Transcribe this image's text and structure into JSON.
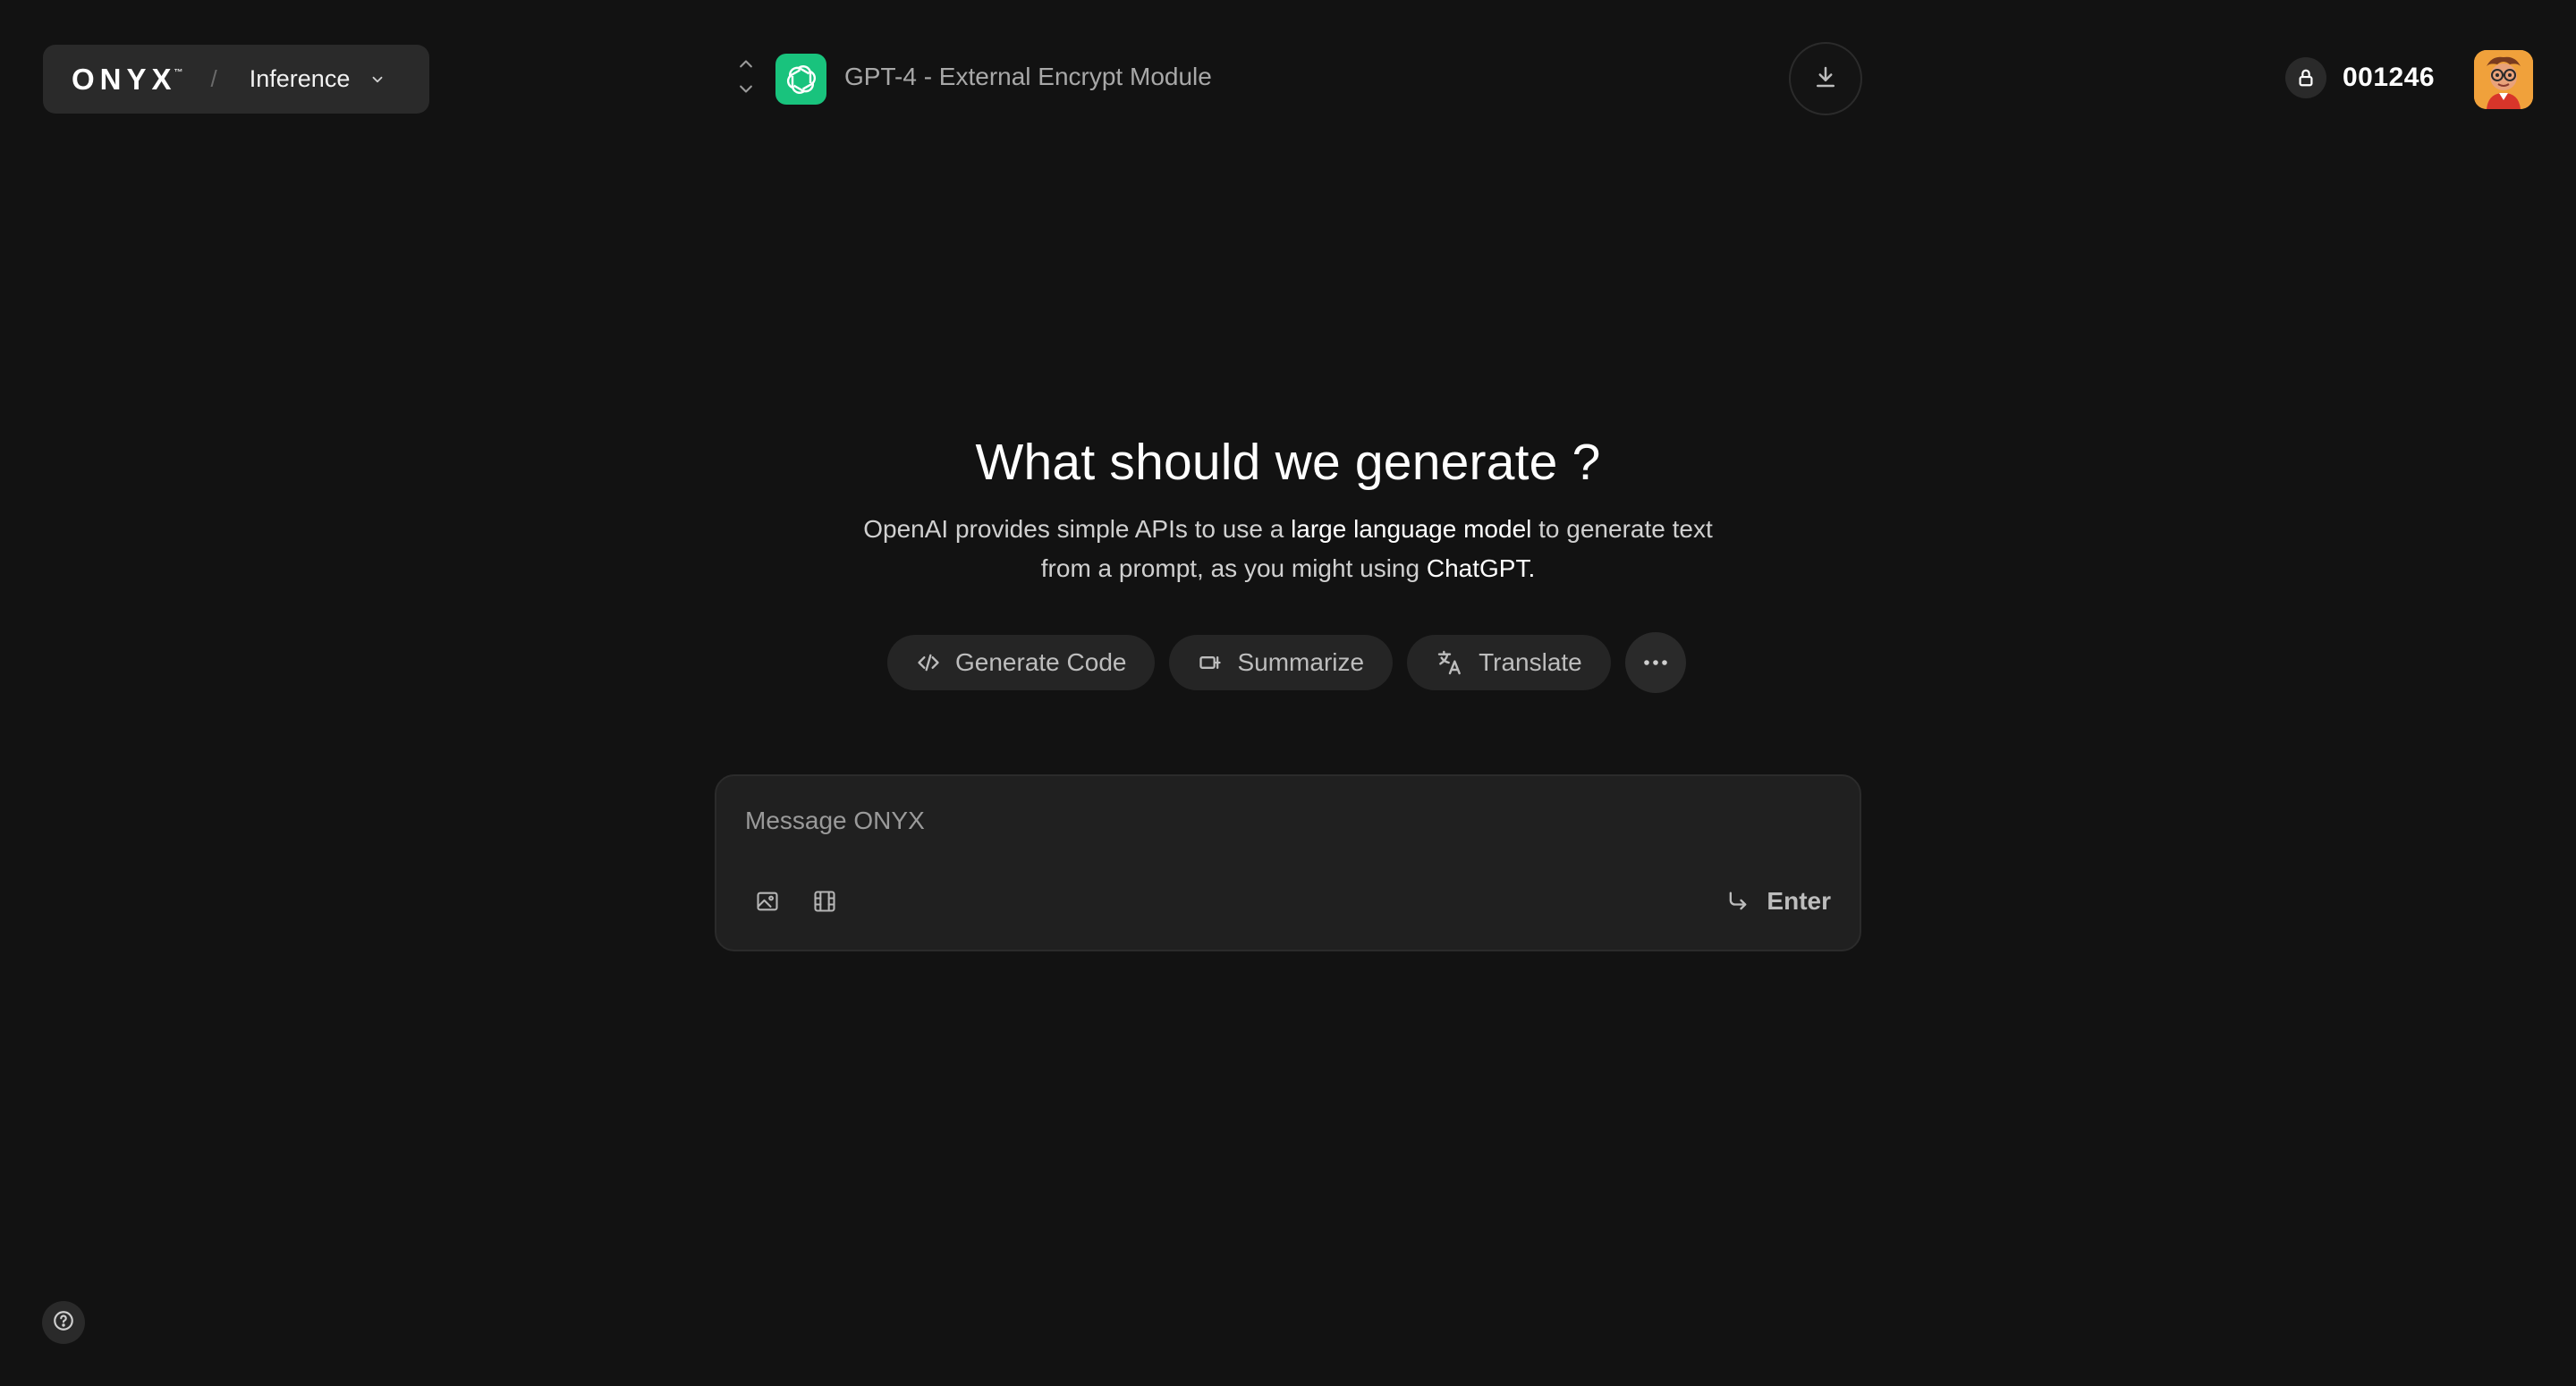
{
  "brand": {
    "logo": "ONYX",
    "trademark": "™",
    "separator": "/",
    "section": "Inference"
  },
  "model": {
    "name": "GPT-4 - External Encrypt Module",
    "logo_color": "#19c37d"
  },
  "credits": {
    "value": "001246"
  },
  "hero": {
    "title": "What should we generate ?",
    "desc_part1": "OpenAI provides simple APIs to use a ",
    "desc_bold1": "large language model",
    "desc_part2": " to generate text from a prompt, as you might using ",
    "desc_bold2": "ChatGPT."
  },
  "actions": [
    {
      "label": "Generate Code",
      "icon": "code-icon"
    },
    {
      "label": "Summarize",
      "icon": "summarize-icon"
    },
    {
      "label": "Translate",
      "icon": "translate-icon"
    }
  ],
  "composer": {
    "placeholder": "Message ONYX",
    "value": "",
    "enter_label": "Enter"
  },
  "colors": {
    "background": "#121212",
    "panel": "#202020",
    "chip": "#252525",
    "accent": "#19c37d",
    "avatar_bg": "#f0a13b"
  }
}
